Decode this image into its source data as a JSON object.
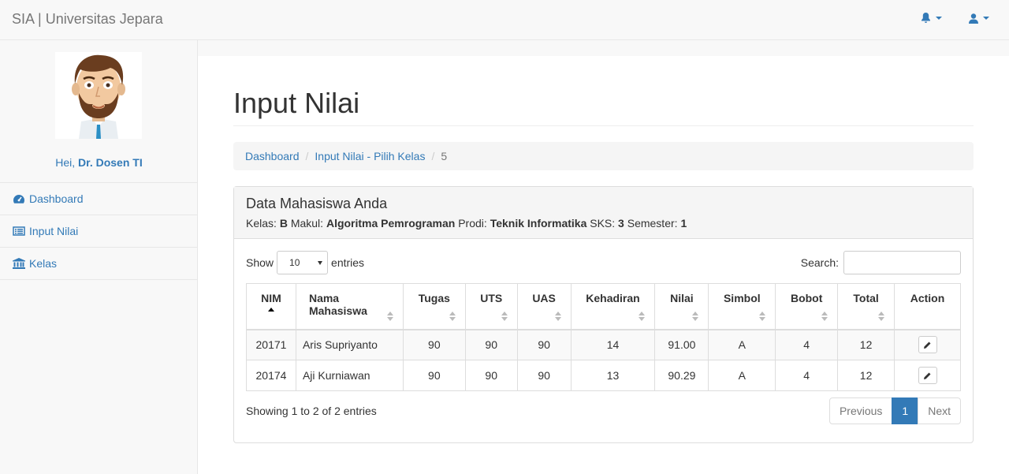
{
  "brand": "SIA | Universitas Jepara",
  "nav": {
    "notifications_icon": "bell-icon",
    "user_icon": "user-icon"
  },
  "sidebar": {
    "greeting_prefix": "Hei, ",
    "user_name": "Dr. Dosen TI",
    "items": [
      {
        "label": "Dashboard",
        "icon": "dashboard-icon"
      },
      {
        "label": "Input Nilai",
        "icon": "list-icon"
      },
      {
        "label": "Kelas",
        "icon": "university-icon"
      }
    ]
  },
  "page_title": "Input Nilai",
  "breadcrumb": {
    "item1": "Dashboard",
    "item2": "Input Nilai - Pilih Kelas",
    "current": "5"
  },
  "panel": {
    "title": "Data Mahasiswa Anda",
    "kelas_label": "Kelas: ",
    "kelas": "B",
    "makul_label": " Makul: ",
    "makul": "Algoritma Pemrograman",
    "prodi_label": " Prodi: ",
    "prodi": "Teknik Informatika",
    "sks_label": " SKS: ",
    "sks": "3",
    "semester_label": " Semester: ",
    "semester": "1"
  },
  "table_controls": {
    "show_label": "Show",
    "entries_value": "10",
    "entries_label": "entries",
    "search_label": "Search:"
  },
  "table": {
    "headers": [
      "NIM",
      "Nama Mahasiswa",
      "Tugas",
      "UTS",
      "UAS",
      "Kehadiran",
      "Nilai",
      "Simbol",
      "Bobot",
      "Total",
      "Action"
    ],
    "rows": [
      [
        "20171",
        "Aris Supriyanto",
        "90",
        "90",
        "90",
        "14",
        "91.00",
        "A",
        "4",
        "12"
      ],
      [
        "20174",
        "Aji Kurniawan",
        "90",
        "90",
        "90",
        "13",
        "90.29",
        "A",
        "4",
        "12"
      ]
    ]
  },
  "footer": {
    "info": "Showing 1 to 2 of 2 entries",
    "prev": "Previous",
    "page": "1",
    "next": "Next"
  }
}
